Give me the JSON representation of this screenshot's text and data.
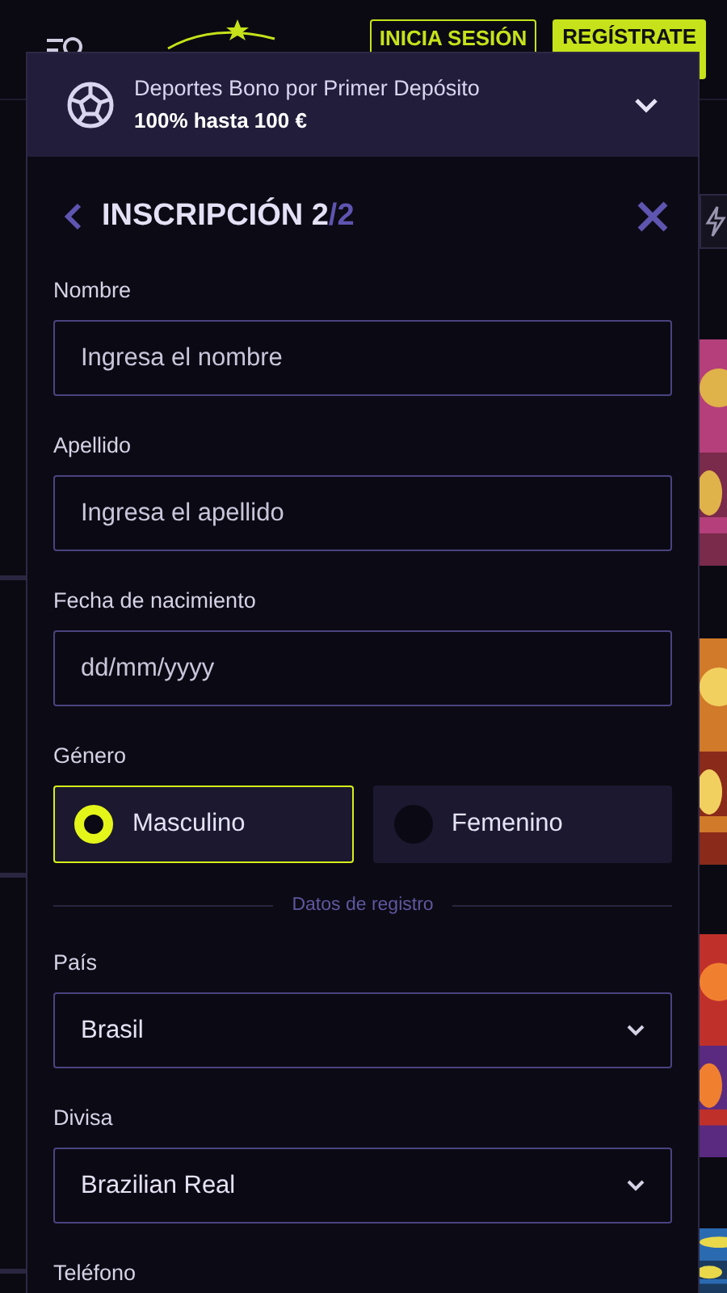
{
  "header": {
    "login_button": "INICIA SESIÓN",
    "register_button": "REGÍSTRATE"
  },
  "promo": {
    "title": "Deportes Bono por Primer Depósito",
    "subtitle": "100% hasta 100 €"
  },
  "form": {
    "title": "INSCRIPCIÓN 2",
    "step_total": "/2",
    "fields": [
      {
        "kind": "text",
        "label": "Nombre",
        "placeholder": "Ingresa el nombre"
      },
      {
        "kind": "text",
        "label": "Apellido",
        "placeholder": "Ingresa el apellido"
      },
      {
        "kind": "text",
        "label": "Fecha de nacimiento",
        "placeholder": "dd/mm/yyyy"
      },
      {
        "kind": "radio",
        "label": "Género",
        "options": [
          {
            "label": "Masculino",
            "selected": true
          },
          {
            "label": "Femenino",
            "selected": false
          }
        ]
      },
      {
        "kind": "divider",
        "label": "Datos de registro"
      },
      {
        "kind": "select",
        "label": "País",
        "value": "Brasil"
      },
      {
        "kind": "select",
        "label": "Divisa",
        "value": "Brazilian Real"
      },
      {
        "kind": "text",
        "label": "Teléfono"
      }
    ]
  }
}
